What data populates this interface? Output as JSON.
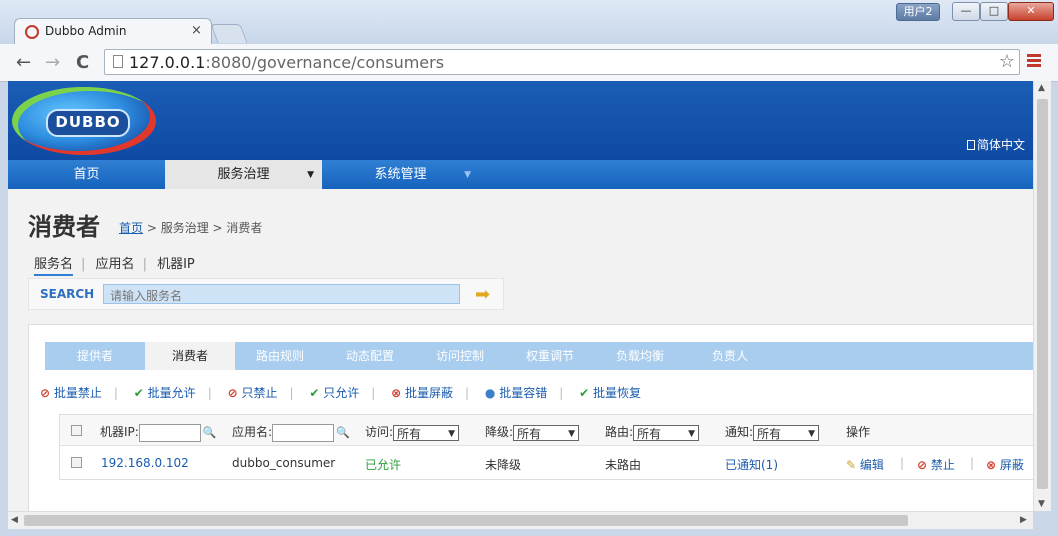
{
  "browser": {
    "tab_title": "Dubbo Admin",
    "tab_close": "×",
    "user_badge": "用户2",
    "url_host": "127.0.0.1",
    "url_rest": ":8080/governance/consumers",
    "back": "←",
    "forward": "→",
    "reload": "C",
    "star": "☆",
    "win_min": "—",
    "win_max": "□",
    "win_close": "✕"
  },
  "header": {
    "logo_text": "DUBBO",
    "lang_link": "简体中文"
  },
  "main_menu": {
    "home": "首页",
    "service_governance": "服务治理",
    "system_management": "系统管理",
    "caret": "▼"
  },
  "page": {
    "title": "消费者",
    "breadcrumb_home": "首页",
    "breadcrumb_rest": " > 服务治理 > 消费者"
  },
  "search": {
    "tabs": [
      "服务名",
      "应用名",
      "机器IP"
    ],
    "label": "SEARCH",
    "placeholder": "请输入服务名",
    "go_icon": "➡"
  },
  "subtabs": [
    "提供者",
    "消费者",
    "路由规则",
    "动态配置",
    "访问控制",
    "权重调节",
    "负载均衡",
    "负责人"
  ],
  "actions": {
    "batch_forbid": "批量禁止",
    "batch_allow": "批量允许",
    "only_forbid": "只禁止",
    "only_allow": "只允许",
    "batch_shield": "批量屏蔽",
    "batch_tolerance": "批量容错",
    "batch_restore": "批量恢复",
    "sep": "|",
    "icon_ban": "⊘",
    "icon_ok": "✔",
    "icon_x": "⊗",
    "icon_dot": "●"
  },
  "table": {
    "headers": {
      "ip": "机器IP:",
      "app": "应用名:",
      "access": "访问:",
      "degrade": "降级:",
      "route": "路由:",
      "notify": "通知:",
      "ops": "操作"
    },
    "filter_value": "所有",
    "search_icon": "🔍",
    "row": {
      "ip": "192.168.0.102",
      "app": "dubbo_consumer",
      "access": "已允许",
      "degrade": "未降级",
      "route": "未路由",
      "notify": "已通知(1)",
      "edit": "编辑",
      "forbid": "禁止",
      "shield": "屏蔽",
      "icon_edit": "✎"
    }
  }
}
